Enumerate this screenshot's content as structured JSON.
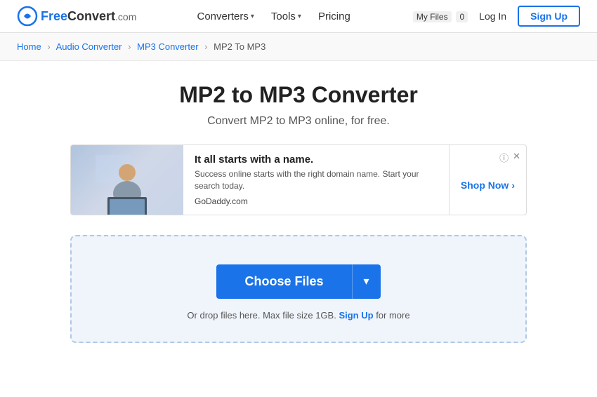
{
  "logo": {
    "free": "Free",
    "convert": "Convert",
    "domain": ".com"
  },
  "nav": {
    "converters_label": "Converters",
    "tools_label": "Tools",
    "pricing_label": "Pricing"
  },
  "header_right": {
    "my_files_label": "My Files",
    "my_files_count": "0",
    "login_label": "Log In",
    "signup_label": "Sign Up"
  },
  "breadcrumb": {
    "home": "Home",
    "audio_converter": "Audio Converter",
    "mp3_converter": "MP3 Converter",
    "current": "MP2 To MP3"
  },
  "main": {
    "title": "MP2 to MP3 Converter",
    "subtitle": "Convert MP2 to MP3 online, for free."
  },
  "ad": {
    "title": "It all starts with a name.",
    "description": "Success online starts with the right domain name. Start your search today.",
    "brand": "GoDaddy.com",
    "shop_now": "Shop Now"
  },
  "dropzone": {
    "choose_files_label": "Choose Files",
    "dropdown_arrow": "▾",
    "drop_info": "Or drop files here. Max file size 1GB.",
    "signup_link": "Sign Up",
    "drop_suffix": "for more"
  }
}
